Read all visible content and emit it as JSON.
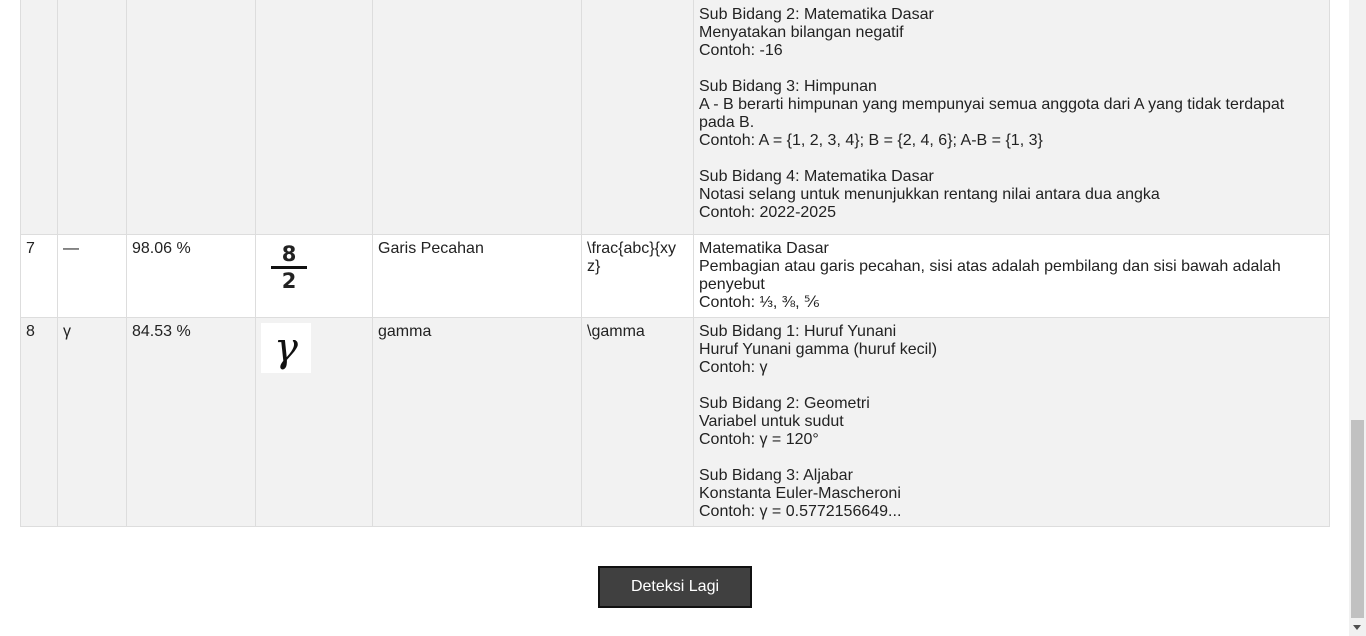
{
  "rows": [
    {
      "no": "",
      "symbol": "",
      "confidence": "",
      "image": "",
      "name": "",
      "latex": "",
      "desc": [
        [
          "Sub Bidang 2: Matematika Dasar",
          "Menyatakan bilangan negatif",
          "Contoh: -16"
        ],
        [
          "Sub Bidang 3: Himpunan",
          "A - B berarti himpunan yang mempunyai semua anggota dari A yang tidak terdapat pada B.",
          "Contoh: A = {1, 2, 3, 4}; B = {2, 4, 6}; A-B = {1, 3}"
        ],
        [
          "Sub Bidang 4: Matematika Dasar",
          "Notasi selang untuk menunjukkan rentang nilai antara dua angka",
          "Contoh: 2022-2025"
        ]
      ]
    },
    {
      "no": "7",
      "symbol": "—",
      "confidence": "98.06 %",
      "image": {
        "numerator": "8",
        "denominator": "2"
      },
      "name": "Garis Pecahan",
      "latex": "\\frac{abc}{xyz}",
      "desc": [
        [
          "Matematika Dasar",
          "Pembagian atau garis pecahan, sisi atas adalah pembilang dan sisi bawah adalah penyebut",
          "Contoh: ⅓, ⅜, ⅚"
        ]
      ]
    },
    {
      "no": "8",
      "symbol": "γ",
      "confidence": "84.53 %",
      "image": {
        "glyph": "γ"
      },
      "name": "gamma",
      "latex": "\\gamma",
      "desc": [
        [
          "Sub Bidang 1: Huruf Yunani",
          "Huruf Yunani gamma (huruf kecil)",
          "Contoh: γ"
        ],
        [
          "Sub Bidang 2: Geometri",
          "Variabel untuk sudut",
          "Contoh: γ = 120°"
        ],
        [
          "Sub Bidang 3: Aljabar",
          "Konstanta Euler-Mascheroni",
          "Contoh: γ = 0.5772156649..."
        ]
      ]
    }
  ],
  "detect_again_label": "Deteksi Lagi"
}
